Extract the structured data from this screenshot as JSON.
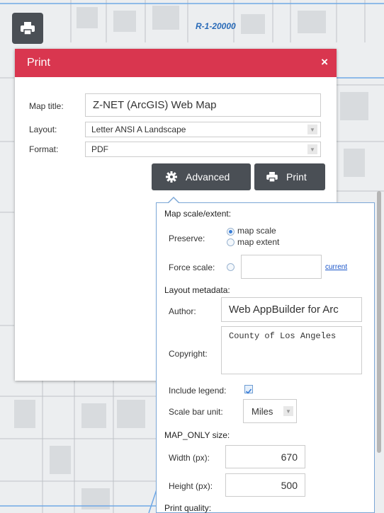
{
  "map": {
    "zone_label": "R-1-20000"
  },
  "print_dialog": {
    "title": "Print",
    "close_symbol": "×",
    "map_title_label": "Map title:",
    "map_title_value": "Z-NET (ArcGIS) Web Map",
    "layout_label": "Layout:",
    "layout_value": "Letter ANSI A Landscape",
    "format_label": "Format:",
    "format_value": "PDF",
    "advanced_label": "Advanced",
    "print_label": "Print"
  },
  "advanced": {
    "scale_extent_heading": "Map scale/extent:",
    "preserve_label": "Preserve:",
    "preserve_options": [
      "map scale",
      "map extent"
    ],
    "preserve_selected": "map scale",
    "force_scale_label": "Force scale:",
    "force_scale_value": "",
    "current_link": "current",
    "layout_metadata_heading": "Layout metadata:",
    "author_label": "Author:",
    "author_value": "Web AppBuilder for Arc",
    "copyright_label": "Copyright:",
    "copyright_value": "County of Los Angeles",
    "include_legend_label": "Include legend:",
    "include_legend_checked": true,
    "scale_bar_unit_label": "Scale bar unit:",
    "scale_bar_unit_value": "Miles",
    "map_only_heading": "MAP_ONLY size:",
    "width_label": "Width (px):",
    "width_value": "670",
    "height_label": "Height (px):",
    "height_value": "500",
    "print_quality_heading": "Print quality:"
  },
  "colors": {
    "header_red": "#d9364f",
    "button_dark": "#4a4f55",
    "link_blue": "#1a55c9",
    "map_line_blue": "#6ea8e6"
  }
}
